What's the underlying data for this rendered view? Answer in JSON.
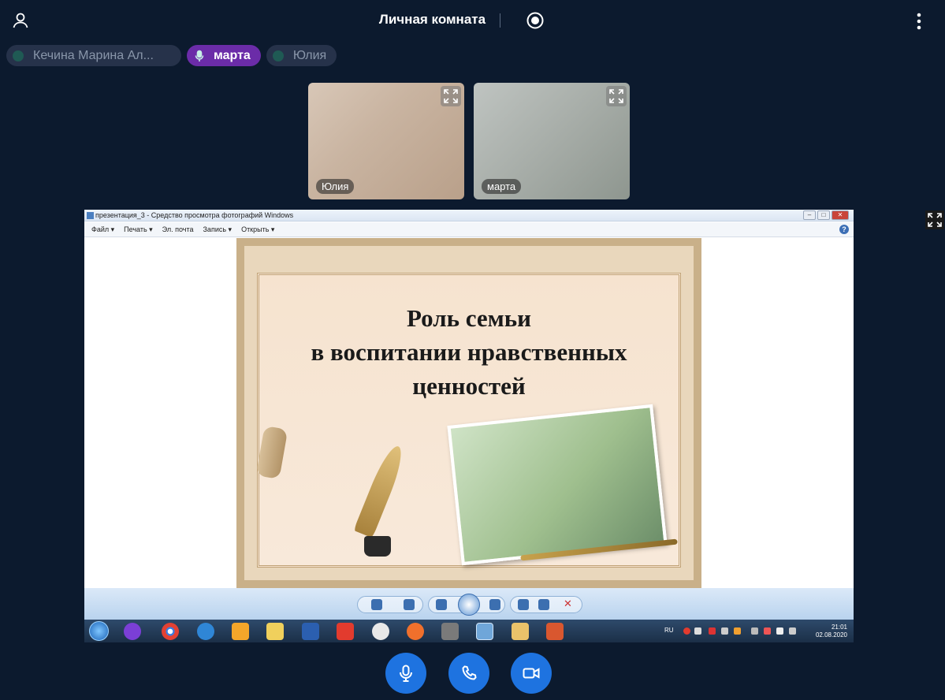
{
  "header": {
    "room_title": "Личная комната"
  },
  "participants_chips": [
    {
      "label": "Кечина Марина Ал...",
      "active": false
    },
    {
      "label": "марта",
      "active": true
    },
    {
      "label": "Юлия",
      "active": false
    }
  ],
  "video_tiles": [
    {
      "name": "Юлия"
    },
    {
      "name": "марта"
    }
  ],
  "shared_screen": {
    "window_title": "презентация_3 - Средство просмотра фотографий Windows",
    "menu": [
      "Файл ▾",
      "Печать ▾",
      "Эл. почта",
      "Запись ▾",
      "Открыть ▾"
    ],
    "help_label": "?",
    "slide_title_lines": [
      "Роль семьи",
      "в  воспитании нравственных",
      "ценностей"
    ],
    "taskbar": {
      "lang": "RU",
      "time": "21:01",
      "date": "02.08.2020"
    }
  },
  "colors": {
    "background": "#0c1a2e",
    "active_chip": "#6b2ca8",
    "call_buttons": "#1e73e0"
  },
  "icons": {
    "user": "user-icon",
    "record": "record-icon",
    "menu": "kebab-menu-icon",
    "mic": "microphone-icon",
    "phone": "phone-icon",
    "camera": "camera-icon",
    "expand": "expand-icon"
  }
}
